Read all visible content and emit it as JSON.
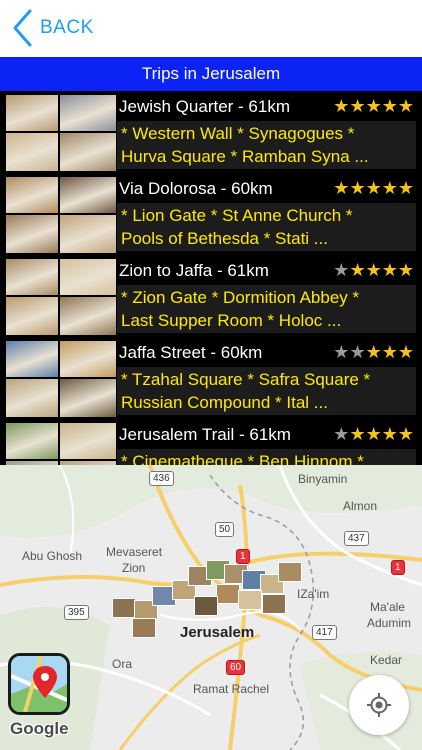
{
  "nav": {
    "back_label": "BACK"
  },
  "header": {
    "title": "Trips in Jerusalem"
  },
  "trips": [
    {
      "name": "Jewish Quarter - 61km",
      "stars_filled": 5,
      "stars_total": 5,
      "line1": "* Western Wall * Synagogues *",
      "line2": "Hurva Square * Ramban Syna ...",
      "thumb_colors": [
        "#b69a74",
        "#8c8f9a",
        "#cdb58f",
        "#a08765"
      ]
    },
    {
      "name": "Via Dolorosa - 60km",
      "stars_filled": 5,
      "stars_total": 5,
      "line1": "* Lion Gate * St Anne Church *",
      "line2": "Pools of Bethesda * Stati ...",
      "thumb_colors": [
        "#b08a5c",
        "#6e5741",
        "#9a7a57",
        "#c2a47b"
      ]
    },
    {
      "name": "Zion to Jaffa - 61km",
      "stars_filled": 4,
      "stars_total": 5,
      "line1": "* Zion Gate * Dormition Abbey *",
      "line2": "Last Supper Room * Holoc ...",
      "thumb_colors": [
        "#a88c64",
        "#d6c29a",
        "#b89a6c",
        "#8e7351"
      ]
    },
    {
      "name": "Jaffa Street - 60km",
      "stars_filled": 3,
      "stars_total": 5,
      "line1": "* Tzahal Square * Safra Square *",
      "line2": "Russian Compound * Ital ...",
      "thumb_colors": [
        "#5d7fa8",
        "#c59b5d",
        "#b9a47e",
        "#6d5a3f"
      ]
    },
    {
      "name": "Jerusalem Trail - 61km",
      "stars_filled": 4,
      "stars_total": 5,
      "line1": "* Cinematheque * Ben Hinnom *",
      "line2": "",
      "thumb_colors": [
        "#7c9a5a",
        "#c9b38a",
        "#9a9a8e",
        "#b8a07c"
      ]
    }
  ],
  "map": {
    "labels": {
      "binyamin": "Binyamin",
      "almon": "Almon",
      "abu_ghosh": "Abu Ghosh",
      "mevaseret": "Mevaseret",
      "zion": "Zion",
      "izaim": "IZa'im",
      "maale": "Ma'ale",
      "adumim": "Adumim",
      "jerusalem": "Jerusalem",
      "ora": "Ora",
      "kedar": "Kedar",
      "ramat_rachel": "Ramat Rachel"
    },
    "roads": {
      "r436": "436",
      "r50": "50",
      "r437": "437",
      "r1a": "1",
      "r1b": "1",
      "r395": "395",
      "r417": "417",
      "r60": "60"
    },
    "attribution": "Google"
  }
}
